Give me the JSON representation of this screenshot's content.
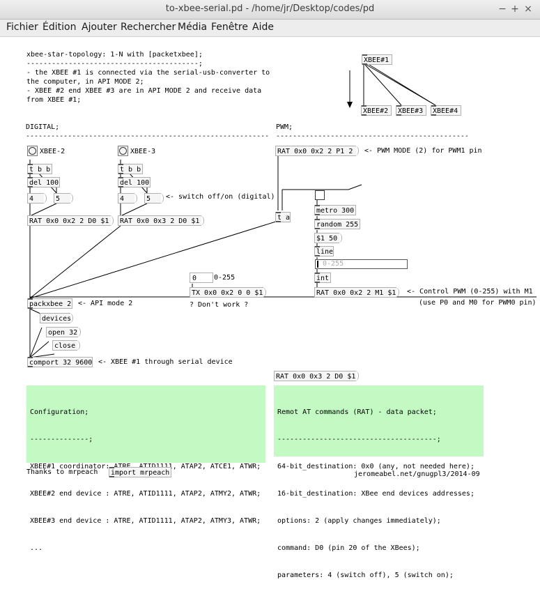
{
  "window": {
    "title": "to-xbee-serial.pd - /home/jr/Desktop/codes/pd",
    "controls": [
      "−",
      "+",
      "×"
    ]
  },
  "menu": [
    "Fichier",
    "Édition",
    "Ajouter",
    "Rechercher",
    "Média",
    "Fenêtre",
    "Aide"
  ],
  "header_comment": [
    "xbee-star-topology: 1-N with [packetxbee];",
    "-----------------------------------------;",
    "- the XBEE #1 is connected via the serial-usb-converter to",
    "the computer, in API MODE 2;",
    "- XBEE #2 end XBEE #3 are in API MODE 2 and receive data",
    "from XBEE #1;"
  ],
  "topology": {
    "xbee1": "XBEE#1",
    "xbee2": "XBEE#2",
    "xbee3": "XBEE#3",
    "xbee4": "XBEE#4"
  },
  "sections": {
    "digital": "DIGITAL;",
    "digital_rule": "----------------------------------------------------------",
    "pwm": "PWM;",
    "pwm_rule": "----------------------------------------------"
  },
  "digital": {
    "bang1_label": "XBEE-2",
    "bang2_label": "XBEE-3",
    "tbb": "t b b",
    "del": "del 100",
    "four": "4",
    "five": "5",
    "switch_comment": "<- switch off/on (digital)",
    "rat1": "RAT 0x0 0x2 2 D0 $1",
    "rat2": "RAT 0x0 0x3 2 D0 $1"
  },
  "pwm": {
    "rat_p1": "RAT 0x0 0x2 2 P1 2",
    "pwm_mode_comment": "<- PWM MODE (2) for PWM1 pin",
    "ta": "t a",
    "metro": "metro 300",
    "random": "random 255",
    "msg50": "$1 50",
    "line": "line",
    "slider_label": "0-255",
    "int": "int",
    "rat_m1": "RAT 0x0 0x2 2 M1 $1",
    "control_comment_1": "<- Control PWM (0-255) with M1",
    "control_comment_2": "(use P0 and M0 for PWM0 pin)"
  },
  "tx": {
    "atom": "0",
    "atom_label": "0-255",
    "tx": "TX 0x0 0x2 0 0 $1",
    "comment": "? Don't work ?"
  },
  "serial": {
    "packxbee": "packxbee 2",
    "api_comment": "<- API mode 2",
    "devices": "devices",
    "open": "open 32",
    "close": "close",
    "comport": "comport 32 9600",
    "comport_comment": "<- XBEE #1 through serial device"
  },
  "rat_bottom": "RAT 0x0 0x3 2 D0 $1",
  "config_box": [
    "Configuration;",
    "--------------;",
    "XBEE#1 coordinator: ATRE, ATID1111, ATAP2, ATCE1, ATWR;",
    "XBEE#2 end device : ATRE, ATID1111, ATAP2, ATMY2, ATWR;",
    "XBEE#3 end device : ATRE, ATID1111, ATAP2, ATMY3, ATWR;",
    "..."
  ],
  "rat_box": [
    "Remot AT commands (RAT) - data packet;",
    "--------------------------------------;",
    "64-bit_destination: 0x0 (any, not needed here);",
    "16-bit_destination: XBee end devices addresses;",
    "options: 2 (apply changes immediately);",
    "command: D0 (pin 20 of the XBees);",
    "parameters: 4 (switch off), 5 (switch on);"
  ],
  "footer": {
    "thanks": "Thanks to mrpeach",
    "import": "import mrpeach",
    "credit": "jeromeabel.net/gnugpl3/2014-09"
  },
  "colors": {
    "comment_box": "#c3f9c3",
    "object_border": "#b0b0b0",
    "wire": "#000000"
  }
}
